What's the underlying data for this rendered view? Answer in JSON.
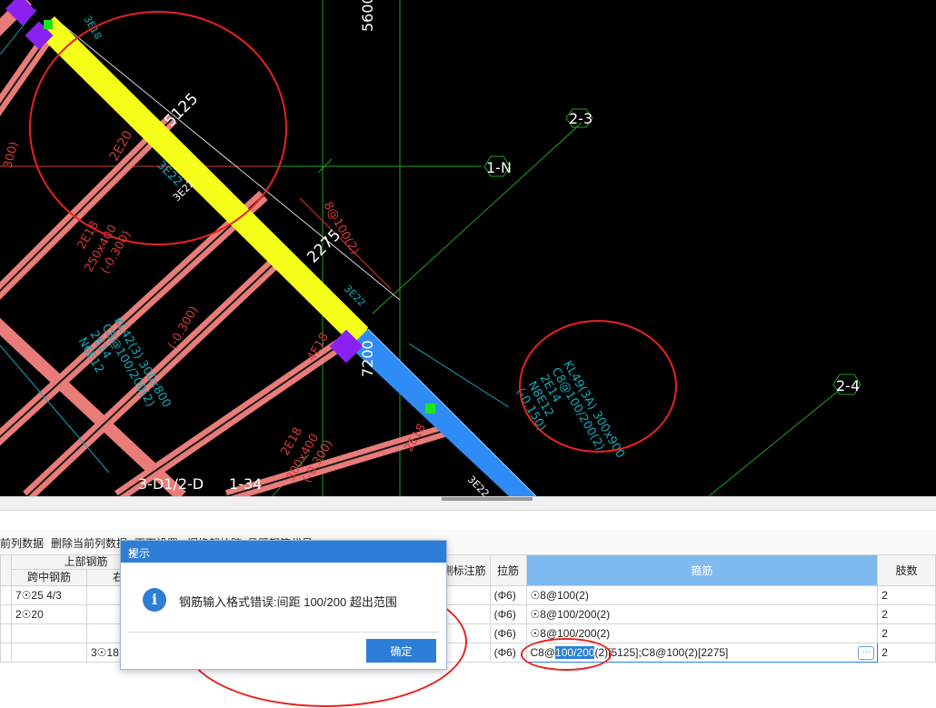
{
  "cad": {
    "dims": {
      "d5600": "5600",
      "d5125": "5125",
      "d2275": "2275",
      "d7200": "7200"
    },
    "axes": {
      "a2_3": "2-3",
      "a1_N": "1-N",
      "a2_4": "2-4",
      "a3_D1_2_D": "3-D1/2-D",
      "a1_34": "1-34"
    },
    "beam_labels": {
      "left_top_3E18": "3E18",
      "left_2E20": "2E20",
      "left_3E22": "3E22",
      "left_3E22b": "3E22",
      "stirrup_8at100_2": "8@100(2)",
      "right_3E22": "3E22",
      "kl42_l1": "KL42(3)  300x800",
      "kl42_l2": "C8@100/200(2)",
      "kl42_l3": "2E14",
      "kl42_l4": "N6E12",
      "kl42_elev": "(-0.300)",
      "b2E18_left": "2E18",
      "b250x400": "250x400",
      "b250_elev": "(-0.300)",
      "b4E18": "4E18",
      "b2E18_mid": "2E18",
      "b300x400": "300x400",
      "b300_elev": "(-0.300)",
      "b2E18_right": "2E18",
      "bottom_3E22": "3E22",
      "kl49_l1": "KL49(3A)  300x900",
      "kl49_l2": "C8@100/200(2)",
      "kl49_l3": "2E14",
      "kl49_l4": "N8E12",
      "kl49_elev": "(-0.150)",
      "left_edge_300": "300)",
      "left_edge_small": "ㄧ"
    }
  },
  "toolbar": {
    "items": [
      "前列数据",
      "删除当前列数据",
      "页面设置",
      "调换起始跨",
      "悬臂钢筋代号"
    ]
  },
  "table": {
    "headers": {
      "top_rebar_group": "上部钢筋",
      "mid_span": "跨中钢筋",
      "right_support": "右支",
      "side_rebar": "侧标注筋",
      "tie_rebar": "拉筋",
      "stirrup": "箍筋",
      "legs": "肢数"
    },
    "rows": [
      {
        "mid": "7☉25 4/3",
        "right": "",
        "tie": "(Φ6)",
        "stirrup": "☉8@100(2)",
        "legs": "2"
      },
      {
        "mid": "2☉20",
        "right": "",
        "tie": "(Φ6)",
        "stirrup": "☉8@100/200(2)",
        "legs": "2"
      },
      {
        "mid": "",
        "right": "",
        "tie": "(Φ6)",
        "stirrup": "☉8@100/200(2)",
        "legs": "2"
      },
      {
        "mid": "",
        "right": "3☉18",
        "tie": "(Φ6)",
        "stirrup": "",
        "legs": "2"
      }
    ],
    "edit_value": {
      "prefix": "C8@",
      "selected": "100/200",
      "suffix": "(2)[5125];C8@100(2)[2275]"
    }
  },
  "dialog": {
    "title": "提示",
    "message": "钢筋输入格式错误:间距 100/200 超出范围",
    "ok_label": "确定",
    "close_symbol": "×",
    "icon_glyph": "i"
  },
  "colors": {
    "beam_pink": "#e97c79",
    "beam_yellow": "#f5ff1a",
    "beam_blue": "#2f8cf6",
    "axis_green": "#1fa41f",
    "label_cyan": "#17a8b8",
    "dim_red": "#d33b3b",
    "annot_red": "#e8231f",
    "purple": "#8a21f0",
    "accent": "#2c7ed6"
  }
}
